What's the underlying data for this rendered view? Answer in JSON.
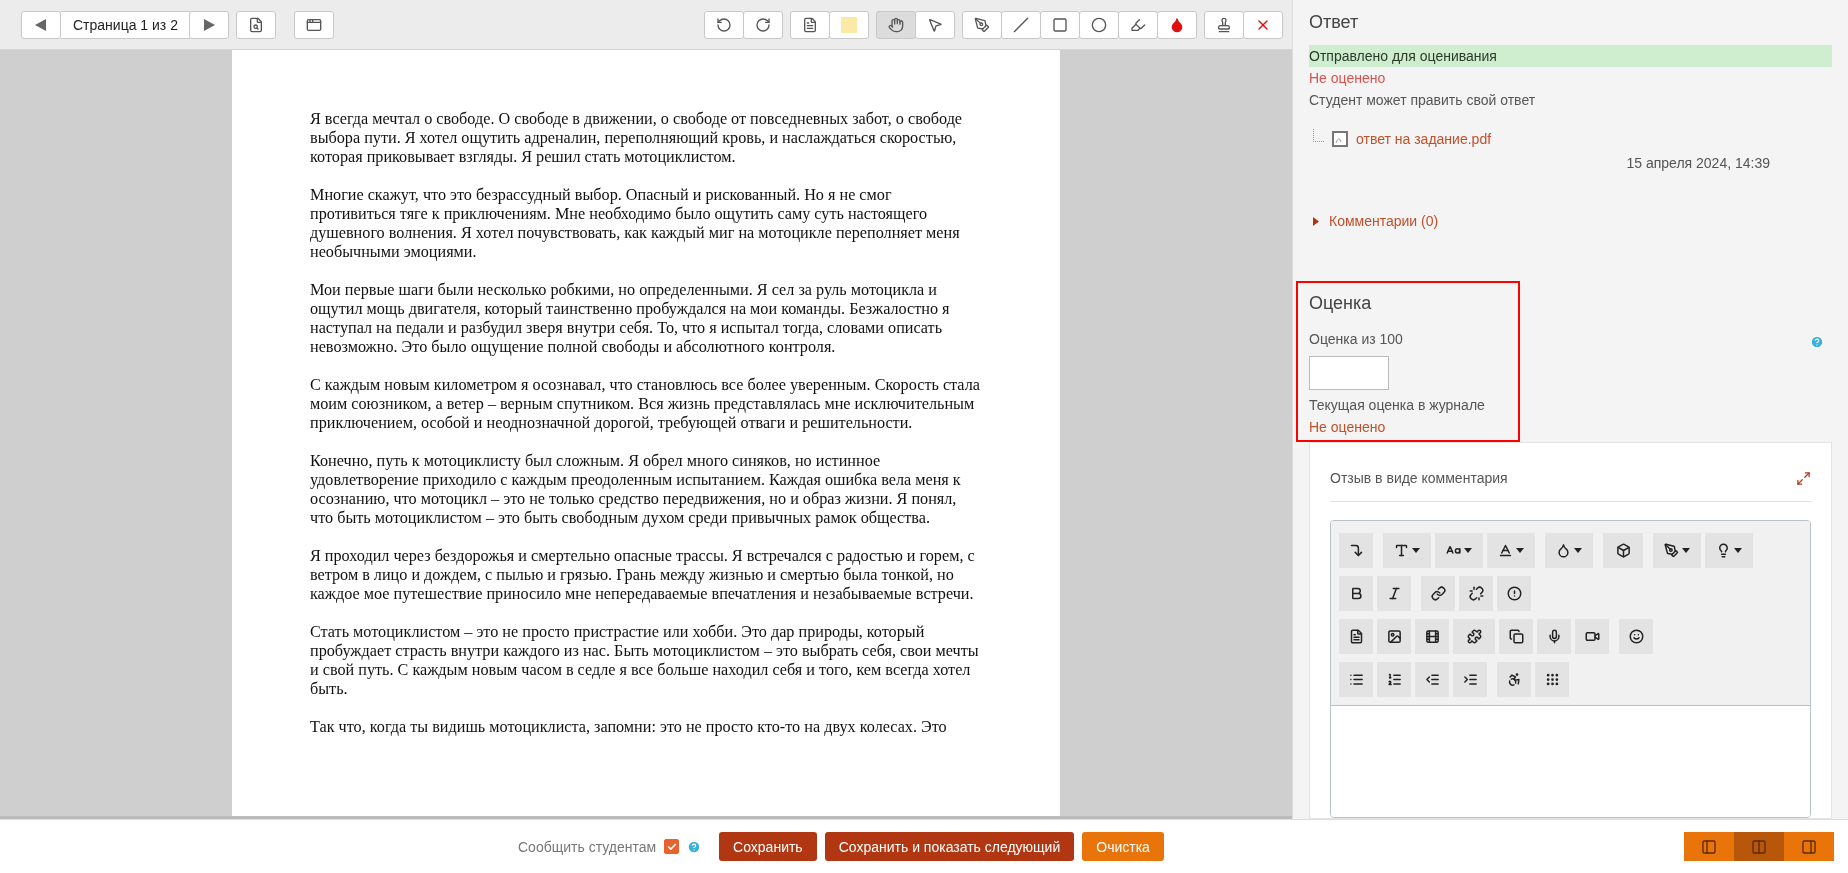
{
  "viewer_toolbar": {
    "page_label": "Страница 1 из 2",
    "tools": [
      {
        "selected": false
      },
      {
        "selected": false
      },
      {
        "selected": false
      },
      {
        "selected": false
      },
      {
        "selected": true
      },
      {
        "selected": false
      },
      {
        "selected": false
      },
      {
        "selected": false
      },
      {
        "selected": false
      },
      {
        "selected": false
      },
      {
        "selected": false
      },
      {
        "selected": false
      },
      {
        "selected": false
      },
      {
        "selected": false
      }
    ]
  },
  "document": {
    "paragraphs": [
      "Я всегда мечтал о свободе. О свободе в движении, о свободе от повседневных забот, о свободе выбора пути. Я хотел ощутить адреналин, переполняющий кровь, и наслаждаться скоростью, которая приковывает взгляды. Я решил стать мотоциклистом.",
      "Многие скажут, что это безрассудный выбор. Опасный и рискованный. Но я не смог противиться тяге к приключениям. Мне необходимо было ощутить саму суть настоящего душевного волнения. Я хотел почувствовать, как каждый миг на мотоцикле переполняет меня необычными эмоциями.",
      "Мои первые шаги были несколько робкими, но определенными. Я сел за руль мотоцикла и ощутил мощь двигателя, который таинственно пробуждался на мои команды. Безжалостно я наступал на педали и разбудил зверя внутри себя. То, что я испытал тогда, словами описать невозможно. Это было ощущение полной свободы и абсолютного контроля.",
      "С каждым новым километром я осознавал, что становлюсь все более уверенным. Скорость стала моим союзником, а ветер – верным спутником. Вся жизнь представлялась мне исключительным приключением, особой и неоднозначной дорогой, требующей отваги и решительности.",
      "Конечно, путь к мотоциклисту был сложным. Я обрел много синяков, но истинное удовлетворение приходило с каждым преодоленным испытанием. Каждая ошибка вела меня к осознанию, что мотоцикл – это не только средство передвижения, но и образ жизни. Я понял, что быть мотоциклистом – это быть свободным духом среди привычных рамок общества.",
      "Я проходил через бездорожья и смертельно опасные трассы. Я встречался с радостью и горем, с ветром в лицо и дождем, с пылью и грязью. Грань между жизнью и смертью была тонкой, но каждое мое путешествие приносило мне непередаваемые впечатления и незабываемые встречи.",
      "Стать мотоциклистом – это не просто пристрастие или хобби. Это дар природы, который пробуждает страсть внутри каждого из нас. Быть мотоциклистом – это выбрать себя, свои мечты и свой путь. С каждым новым часом в седле я все больше находил себя и того, кем всегда хотел быть.",
      "Так что, когда ты видишь мотоциклиста, запомни: это не просто кто-то на двух колесах. Это"
    ]
  },
  "answer": {
    "title": "Ответ",
    "submission_status": "Отправлено для оценивания",
    "grading_status": "Не оценено",
    "edit_note": "Студент может править свой ответ",
    "file_name": "ответ на задание.pdf",
    "file_date": "15 апреля 2024, 14:39",
    "comments_link": "Комментарии (0)",
    "comments_expanded": false
  },
  "grade": {
    "title": "Оценка",
    "label": "Оценка из 100",
    "current_label": "Текущая оценка в журнале",
    "current_value": "Не оценено"
  },
  "feedback": {
    "title": "Отзыв в виде комментария"
  },
  "footer": {
    "notify_label": "Сообщить студентам",
    "notify_checked": true,
    "buttons": [
      {
        "label": "Сохранить",
        "kind": "primary"
      },
      {
        "label": "Сохранить и показать следующий",
        "kind": "primary"
      },
      {
        "label": "Очистка",
        "kind": "secondary"
      }
    ],
    "layouts": [
      {
        "selected": false
      },
      {
        "selected": true
      },
      {
        "selected": false
      }
    ]
  }
}
